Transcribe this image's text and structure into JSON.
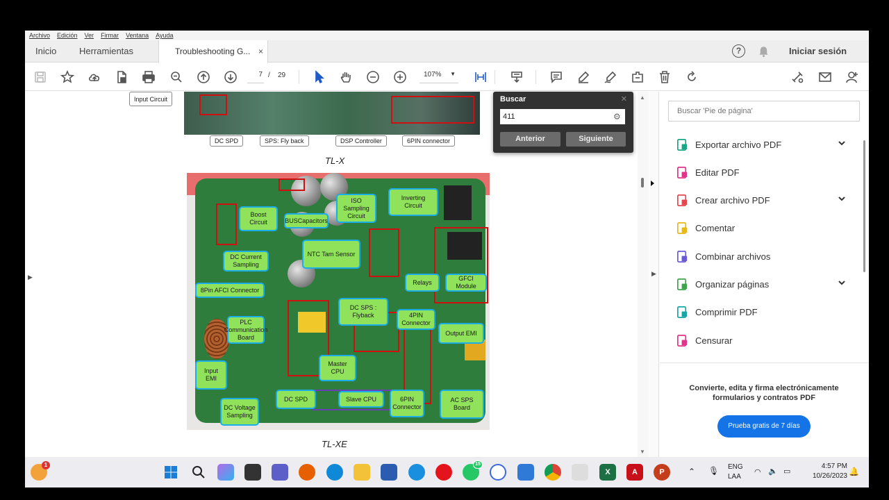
{
  "menubar": [
    "Archivo",
    "Edición",
    "Ver",
    "Firmar",
    "Ventana",
    "Ayuda"
  ],
  "tabs": {
    "home": "Inicio",
    "tools": "Herramientas",
    "document": "Troubleshooting G...",
    "close": "×"
  },
  "header": {
    "signin": "Iniciar sesión",
    "help": "?"
  },
  "toolbar": {
    "page_current": "7",
    "page_sep": "/",
    "page_total": "29",
    "zoom": "107%",
    "icons": [
      "save-icon",
      "bookmark-icon",
      "upload-icon",
      "page-icon",
      "print-icon",
      "zoom-search-icon",
      "page-up-icon",
      "page-down-icon",
      "pointer-icon",
      "hand-icon",
      "zoom-out-icon",
      "zoom-in-icon",
      "fit-page-icon",
      "stamp-icon",
      "comment-icon",
      "highlight-icon",
      "sign-icon",
      "edit-icon",
      "delete-icon",
      "rotate-icon",
      "share-link-icon",
      "mail-icon",
      "account-add-icon"
    ]
  },
  "document": {
    "top_callouts": [
      "Input Circuit",
      "DC SPD",
      "SPS: Fly back",
      "DSP Controller",
      "6PIN connector"
    ],
    "caption_top": "TL-X",
    "caption_bottom": "TL-XE",
    "board_labels": {
      "boost": "Boost Circuit",
      "bus": "BUSCapacitors",
      "iso": "ISO Sampling Circuit",
      "inverting": "Inverting Circuit",
      "ntc": "NTC Tam Sensor",
      "dccur": "DC Current Sampling",
      "afci": "8Pin AFCI Connector",
      "relays": "Relays",
      "gfci": "GFCI Module",
      "plc": "PLC Communication Board",
      "dcsps": "DC SPS : Flyback",
      "pin4": "4PIN Connector",
      "outemi": "Output EMI",
      "inemi": "Input EMI",
      "master": "Master CPU",
      "dcspd": "DC SPD",
      "slave": "Slave CPU",
      "pin6": "6PIN Connector",
      "acsps": "AC SPS Board",
      "dcvolt": "DC Voltage Sampling"
    }
  },
  "search": {
    "title": "Buscar",
    "value": "411",
    "prev": "Anterior",
    "next": "Siguiente"
  },
  "right_pane": {
    "search_placeholder": "Buscar 'Pie de página'",
    "tools": [
      {
        "label": "Exportar archivo PDF",
        "icon": "export-pdf-icon",
        "color": "#1aa587",
        "expand": true
      },
      {
        "label": "Editar PDF",
        "icon": "edit-pdf-icon",
        "color": "#e0348b",
        "expand": false
      },
      {
        "label": "Crear archivo PDF",
        "icon": "create-pdf-icon",
        "color": "#e34850",
        "expand": true
      },
      {
        "label": "Comentar",
        "icon": "comment-icon",
        "color": "#e8b81a",
        "expand": false
      },
      {
        "label": "Combinar archivos",
        "icon": "combine-icon",
        "color": "#6b5ad6",
        "expand": false
      },
      {
        "label": "Organizar páginas",
        "icon": "organize-icon",
        "color": "#3fa34d",
        "expand": true
      },
      {
        "label": "Comprimir PDF",
        "icon": "compress-icon",
        "color": "#1aa5a5",
        "expand": false
      },
      {
        "label": "Censurar",
        "icon": "redact-icon",
        "color": "#e0348b",
        "expand": false
      }
    ],
    "promo": "Convierte, edita y firma electrónicamente formularios y contratos PDF",
    "trial": "Prueba gratis de 7 días"
  },
  "taskbar": {
    "lang": "ENG",
    "lang2": "LAA",
    "time": "4:57 PM",
    "date": "10/26/2023",
    "badge_notif": "1",
    "badge_whatsapp": "15"
  }
}
